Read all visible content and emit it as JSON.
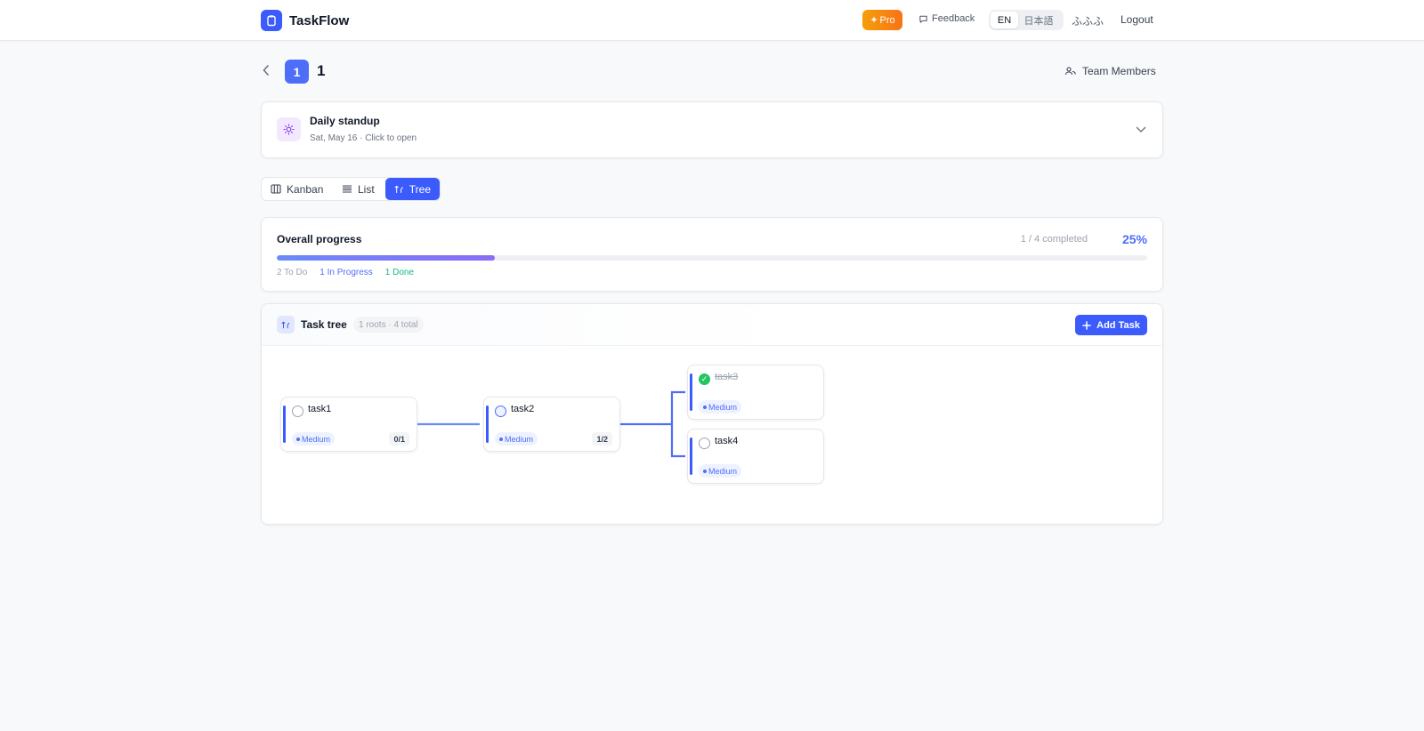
{
  "app": {
    "name": "TaskFlow"
  },
  "header": {
    "pro_label": "Pro",
    "feedback_label": "Feedback",
    "lang_en": "EN",
    "lang_ja": "日本語",
    "username": "ふふふ",
    "logout_label": "Logout"
  },
  "project": {
    "badge": "1",
    "title": "1",
    "team_label": "Team Members"
  },
  "standup": {
    "title": "Daily standup",
    "subtitle": "Sat, May 16 · Click to open"
  },
  "views": {
    "kanban": "Kanban",
    "list": "List",
    "tree": "Tree",
    "active": "tree"
  },
  "progress": {
    "title": "Overall progress",
    "completed_text": "1 / 4 completed",
    "percent_text": "25%",
    "fraction": 0.25,
    "todo": "2 To Do",
    "in_progress": "1 In Progress",
    "done": "1 Done"
  },
  "tree": {
    "title": "Task tree",
    "meta": "1 roots · 4 total",
    "add_label": "Add Task",
    "nodes": [
      {
        "name": "task1",
        "status": "todo",
        "priority": "Medium",
        "count": "0/1"
      },
      {
        "name": "task2",
        "status": "in-progress",
        "priority": "Medium",
        "count": "1/2"
      },
      {
        "name": "task3",
        "status": "done",
        "priority": "Medium"
      },
      {
        "name": "task4",
        "status": "todo",
        "priority": "Medium"
      }
    ]
  },
  "colors": {
    "accent": "#3b5bfd",
    "done": "#22c55e",
    "pro": "#f59e0b"
  }
}
